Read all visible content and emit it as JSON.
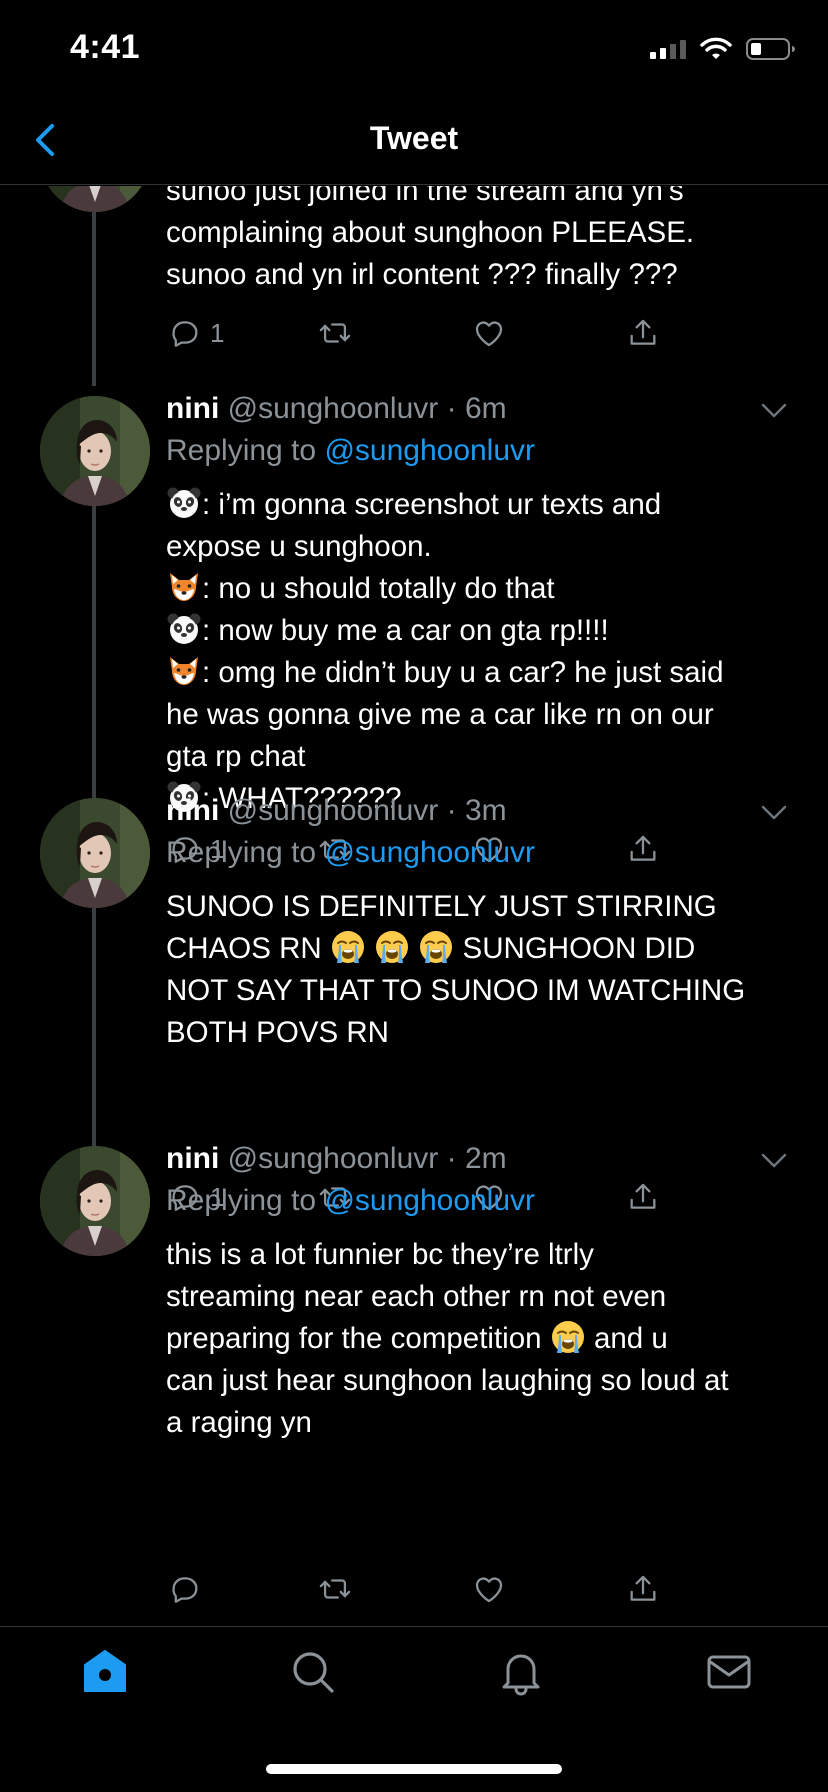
{
  "status_bar": {
    "time": "4:41"
  },
  "nav": {
    "title": "Tweet"
  },
  "prev_tweet": {
    "lines": [
      "sunoo just joined in the stream and yn’s",
      "complaining about sunghoon PLEEASE.",
      "sunoo and yn irl content ??? finally ???"
    ],
    "reply_count": "1"
  },
  "tweets": [
    {
      "name": "nini",
      "handle": "@sunghoonluvr",
      "dot": "·",
      "time": "6m",
      "replying_prefix": "Replying to ",
      "replying_mention": "@sunghoonluvr",
      "lines": [
        {
          "emoji": "panda",
          "text": ": i’m gonna screenshot ur texts and"
        },
        {
          "text": "expose u sunghoon."
        },
        {
          "emoji": "fox",
          "text": ": no u should totally do that"
        },
        {
          "emoji": "panda",
          "text": ": now buy me a car on gta rp!!!!"
        },
        {
          "emoji": "fox",
          "text": ": omg he didn’t buy u a car? he just said"
        },
        {
          "text": "he was gonna give me a car like rn on our"
        },
        {
          "text": "gta rp chat"
        },
        {
          "emoji": "panda",
          "text": ": WHAT??????"
        }
      ],
      "reply_count": "1"
    },
    {
      "name": "nini",
      "handle": "@sunghoonluvr",
      "dot": "·",
      "time": "3m",
      "replying_prefix": "Replying to ",
      "replying_mention": "@sunghoonluvr",
      "lines": [
        "SUNOO IS DEFINITELY JUST STIRRING",
        "CHAOS RN",
        "SUNGHOON DID",
        "NOT SAY THAT TO SUNOO IM WATCHING",
        "BOTH POVS RN"
      ],
      "reply_count": "1"
    },
    {
      "name": "nini",
      "handle": "@sunghoonluvr",
      "dot": "·",
      "time": "2m",
      "replying_prefix": "Replying to ",
      "replying_mention": "@sunghoonluvr",
      "lines": [
        "this is a lot funnier bc they’re ltrly",
        "streaming near each other rn not even",
        "preparing for the competition",
        "and u",
        "can just hear sunghoon laughing so loud at",
        "a raging yn"
      ],
      "reply_count": ""
    }
  ],
  "icons": {
    "back": "chevron-left-icon",
    "reply": "reply-icon",
    "retweet": "retweet-icon",
    "like": "heart-icon",
    "share": "share-icon",
    "caret": "chevron-down-icon",
    "emoji_panda": "panda-emoji-icon",
    "emoji_fox": "fox-emoji-icon",
    "emoji_crying": "loudly-crying-emoji-icon",
    "tab_home": "home-icon",
    "tab_search": "search-icon",
    "tab_notifications": "bell-icon",
    "tab_messages": "mail-icon"
  },
  "colors": {
    "background": "#000000",
    "accent": "#1d9bf0",
    "secondary_text": "#8b9298",
    "divider": "#2f3336"
  }
}
